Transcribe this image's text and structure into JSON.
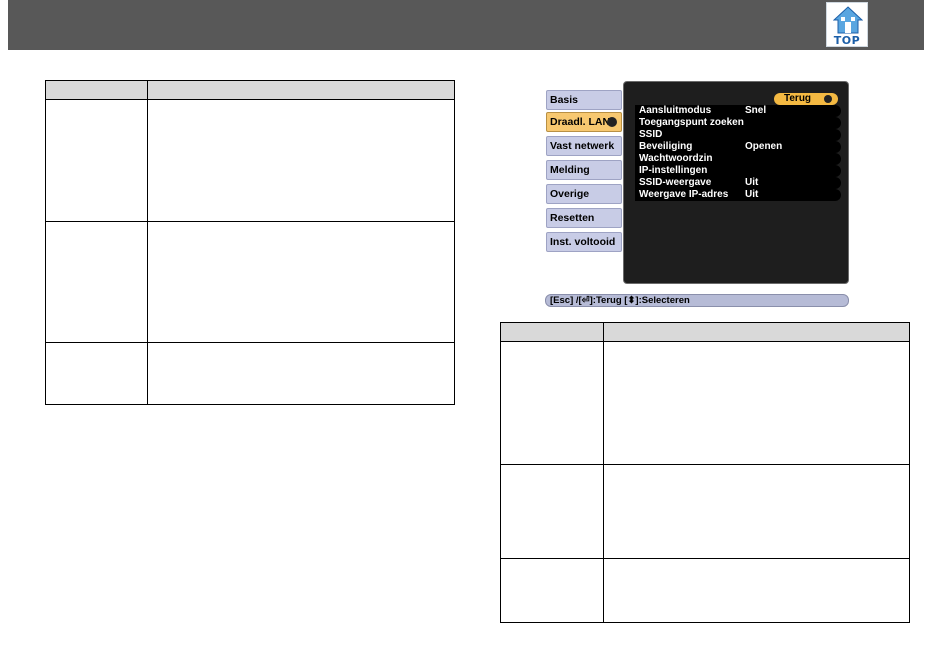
{
  "header": {
    "logo_text": "TOP",
    "logo_icon": "house-icon"
  },
  "osd": {
    "tabs": [
      {
        "label": "Basis"
      },
      {
        "label": "Draadl. LAN"
      },
      {
        "label": "Vast netwerk"
      },
      {
        "label": "Melding"
      },
      {
        "label": "Overige"
      },
      {
        "label": "Resetten"
      },
      {
        "label": "Inst. voltooid"
      }
    ],
    "active_tab": "Draadl. LAN",
    "back_label": "Terug",
    "rows": [
      {
        "label": "Aansluitmodus",
        "value": "Snel"
      },
      {
        "label": "Toegangspunt zoeken",
        "value": ""
      },
      {
        "label": "SSID",
        "value": ""
      },
      {
        "label": "Beveiliging",
        "value": "Openen"
      },
      {
        "label": "Wachtwoordzin",
        "value": ""
      },
      {
        "label": "IP-instellingen",
        "value": ""
      },
      {
        "label": "SSID-weergave",
        "value": "Uit"
      },
      {
        "label": "Weergave IP-adres",
        "value": "Uit"
      }
    ],
    "statusbar": "[Esc] /[⏎]:Terug  [⬍]:Selecteren"
  },
  "colors": {
    "header": "#585858",
    "tab": "#c8cce6",
    "tab_active": "#f7c870",
    "back_pill": "#f4b942",
    "panel": "#1e1e1e",
    "table_header": "#d9d9d9"
  }
}
